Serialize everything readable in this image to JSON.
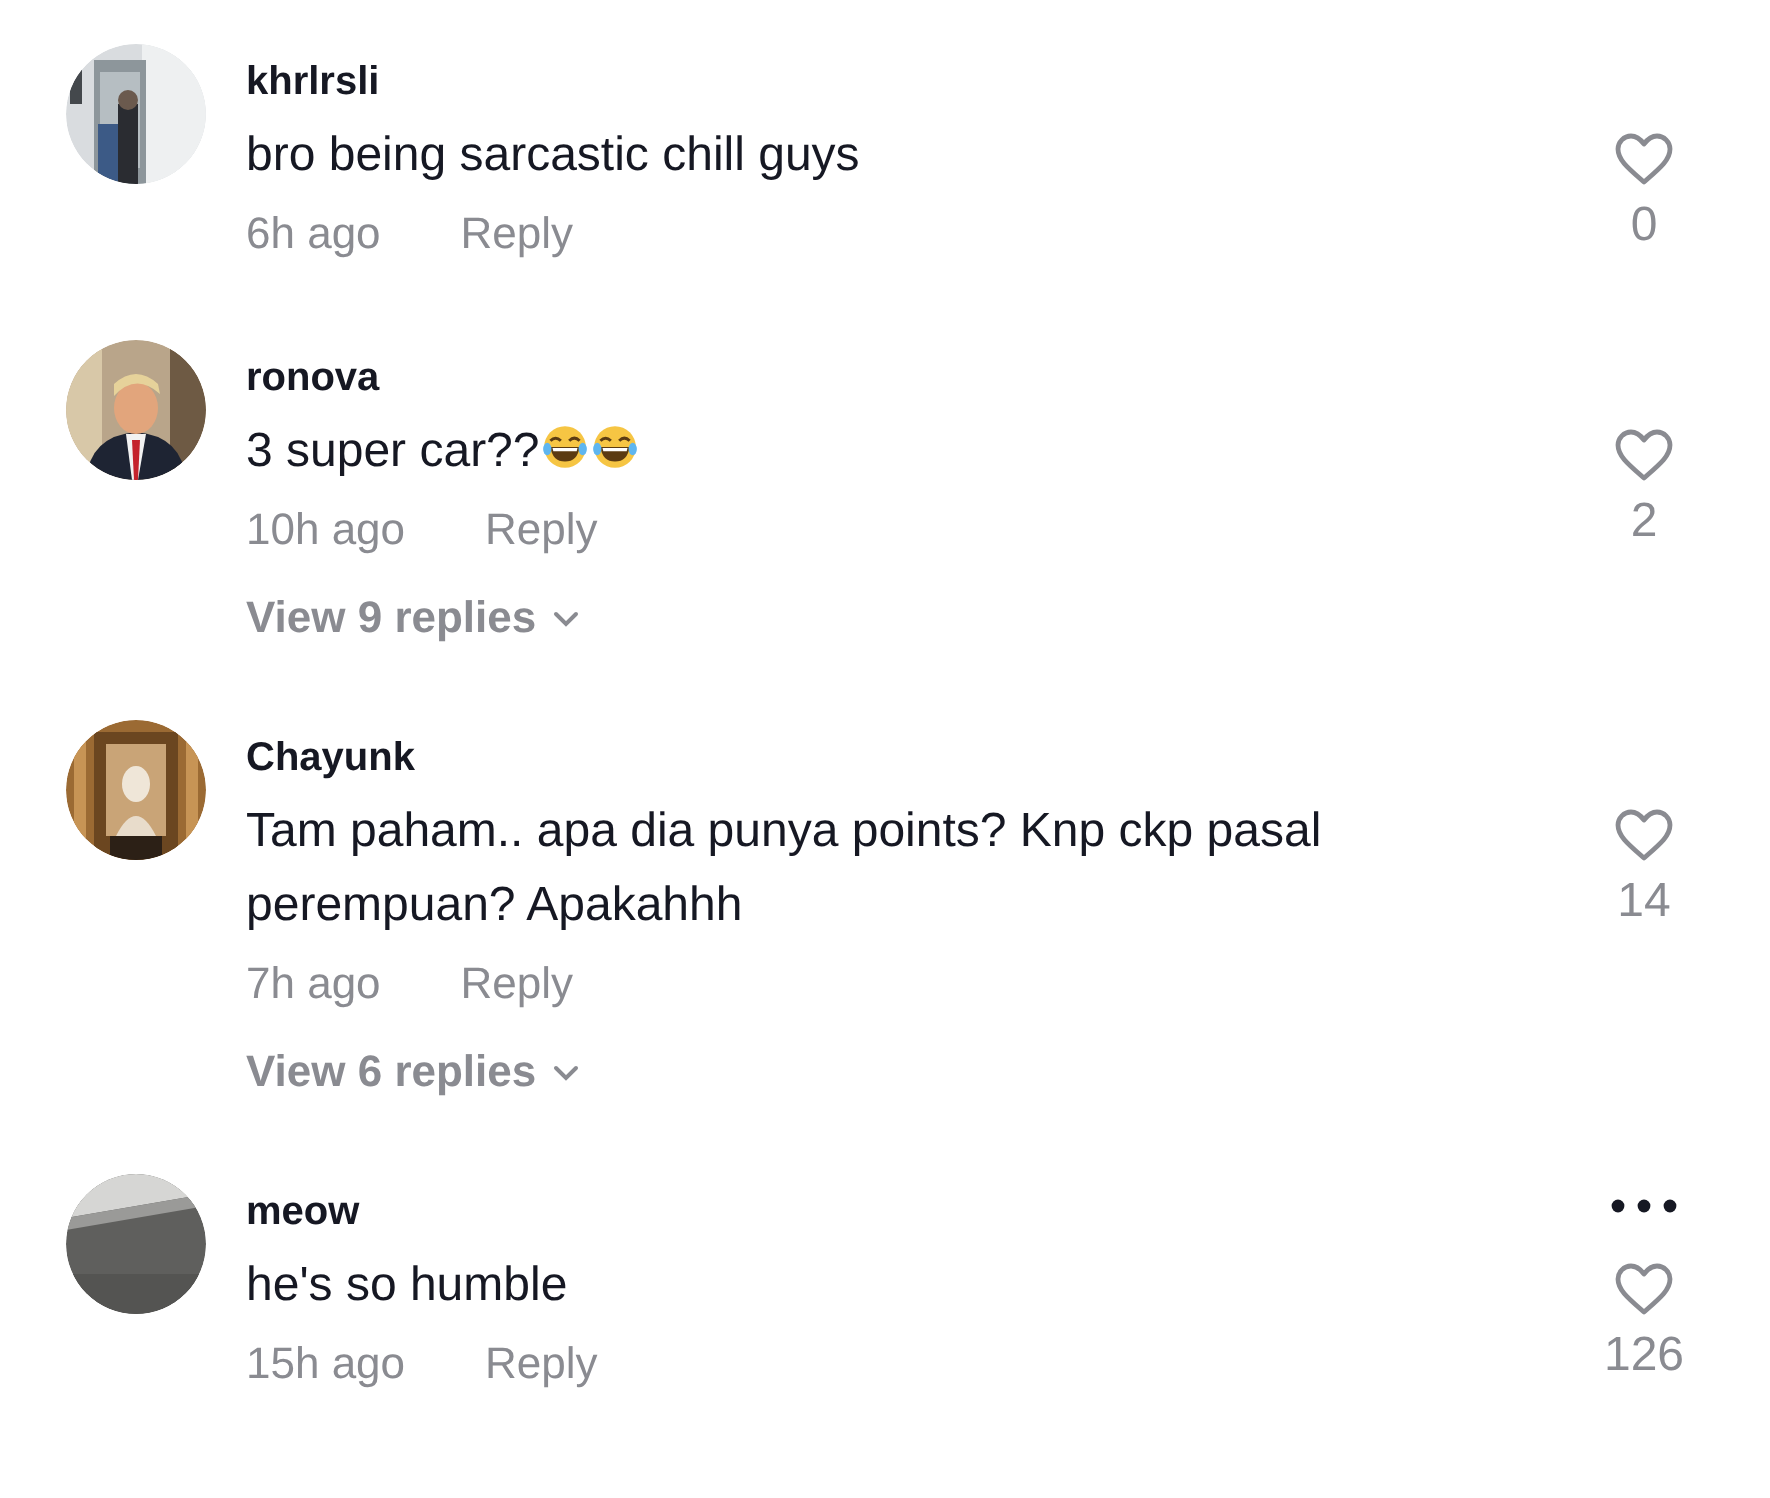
{
  "comments": [
    {
      "username": "khrlrsli",
      "text": "bro being sarcastic chill guys",
      "time": "6h ago",
      "reply": "Reply",
      "likes": "0",
      "liked": false,
      "more_options": false
    },
    {
      "username": "ronova",
      "text": "3 super car??",
      "trailing_icons": [
        {
          "kind": "laughing"
        },
        {
          "kind": "laughing"
        }
      ],
      "time": "10h ago",
      "reply": "Reply",
      "view_replies": "View 9 replies",
      "likes": "2",
      "liked": false,
      "more_options": false
    },
    {
      "username": "Chayunk",
      "text": "Tam paham.. apa dia punya points? Knp ckp pasal perempuan? Apakahhh",
      "time": "7h ago",
      "reply": "Reply",
      "view_replies": "View 6 replies",
      "likes": "14",
      "liked": false,
      "more_options": false
    },
    {
      "username": "meow",
      "text": "he's so humble",
      "time": "15h ago",
      "reply": "Reply",
      "likes": "126",
      "liked": false,
      "more_options": true
    }
  ]
}
